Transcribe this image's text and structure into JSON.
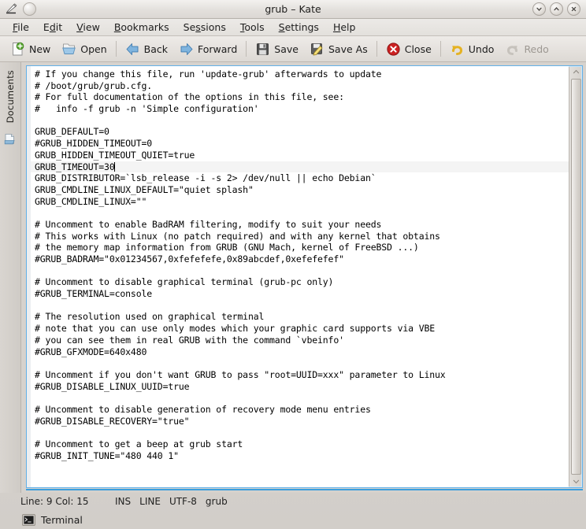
{
  "window": {
    "title": "grub – Kate",
    "app_icon": "kate-pencil-icon",
    "sticky_icon": "keep-above-icon",
    "buttons": [
      {
        "name": "minimize-button",
        "glyph": "chevron-down"
      },
      {
        "name": "maximize-button",
        "glyph": "chevron-up"
      },
      {
        "name": "close-button",
        "glyph": "x-mark"
      }
    ]
  },
  "menubar": {
    "items": [
      {
        "label": "File",
        "mnemonic": "F"
      },
      {
        "label": "Edit",
        "mnemonic": "E"
      },
      {
        "label": "View",
        "mnemonic": "V"
      },
      {
        "label": "Bookmarks",
        "mnemonic": "B"
      },
      {
        "label": "Sessions",
        "mnemonic": "S"
      },
      {
        "label": "Tools",
        "mnemonic": "T"
      },
      {
        "label": "Settings",
        "mnemonic": "S"
      },
      {
        "label": "Help",
        "mnemonic": "H"
      }
    ]
  },
  "toolbar": {
    "items": [
      {
        "label": "New",
        "icon": "new-document-icon",
        "enabled": true
      },
      {
        "label": "Open",
        "icon": "open-folder-icon",
        "enabled": true
      },
      {
        "separator_after": true
      },
      {
        "label": "Back",
        "icon": "arrow-left-icon",
        "enabled": true
      },
      {
        "label": "Forward",
        "icon": "arrow-right-icon",
        "enabled": true
      },
      {
        "separator_after": true
      },
      {
        "label": "Save",
        "icon": "floppy-disk-icon",
        "enabled": true
      },
      {
        "label": "Save As",
        "icon": "save-as-icon",
        "enabled": true
      },
      {
        "separator_after": true
      },
      {
        "label": "Close",
        "icon": "close-circle-icon",
        "enabled": true
      },
      {
        "separator_after": true
      },
      {
        "label": "Undo",
        "icon": "undo-arrow-icon",
        "enabled": true
      },
      {
        "label": "Redo",
        "icon": "redo-arrow-icon",
        "enabled": false
      }
    ]
  },
  "sidebar": {
    "tab_label": "Documents",
    "icon": "documents-icon"
  },
  "editor": {
    "current_line_index": 8,
    "cursor_column": 15,
    "lines": [
      "# If you change this file, run 'update-grub' afterwards to update",
      "# /boot/grub/grub.cfg.",
      "# For full documentation of the options in this file, see:",
      "#   info -f grub -n 'Simple configuration'",
      "",
      "GRUB_DEFAULT=0",
      "#GRUB_HIDDEN_TIMEOUT=0",
      "GRUB_HIDDEN_TIMEOUT_QUIET=true",
      "GRUB_TIMEOUT=30",
      "GRUB_DISTRIBUTOR=`lsb_release -i -s 2> /dev/null || echo Debian`",
      "GRUB_CMDLINE_LINUX_DEFAULT=\"quiet splash\"",
      "GRUB_CMDLINE_LINUX=\"\"",
      "",
      "# Uncomment to enable BadRAM filtering, modify to suit your needs",
      "# This works with Linux (no patch required) and with any kernel that obtains",
      "# the memory map information from GRUB (GNU Mach, kernel of FreeBSD ...)",
      "#GRUB_BADRAM=\"0x01234567,0xfefefefe,0x89abcdef,0xefefefef\"",
      "",
      "# Uncomment to disable graphical terminal (grub-pc only)",
      "#GRUB_TERMINAL=console",
      "",
      "# The resolution used on graphical terminal",
      "# note that you can use only modes which your graphic card supports via VBE",
      "# you can see them in real GRUB with the command `vbeinfo'",
      "#GRUB_GFXMODE=640x480",
      "",
      "# Uncomment if you don't want GRUB to pass \"root=UUID=xxx\" parameter to Linux",
      "#GRUB_DISABLE_LINUX_UUID=true",
      "",
      "# Uncomment to disable generation of recovery mode menu entries",
      "#GRUB_DISABLE_RECOVERY=\"true\"",
      "",
      "# Uncomment to get a beep at grub start",
      "#GRUB_INIT_TUNE=\"480 440 1\""
    ]
  },
  "scrollbar": {
    "up_arrow": "scroll-up-icon",
    "down_arrow": "scroll-down-icon",
    "thumb_position_percent": 0
  },
  "statusbar": {
    "position": "Line: 9 Col: 15",
    "insert_mode": "INS",
    "selection_mode": "LINE",
    "encoding": "UTF-8",
    "document_name": "grub"
  },
  "bottombar": {
    "terminal_label": "Terminal",
    "terminal_icon": "terminal-icon"
  },
  "colors": {
    "focus_border": "#62b0e8",
    "current_line_marker": "#4ea16f",
    "current_line_bg": "#f4f4f4",
    "window_bg": "#d6d2cd",
    "editor_bg": "#ffffff",
    "accent_underline": "#3b9ede"
  }
}
